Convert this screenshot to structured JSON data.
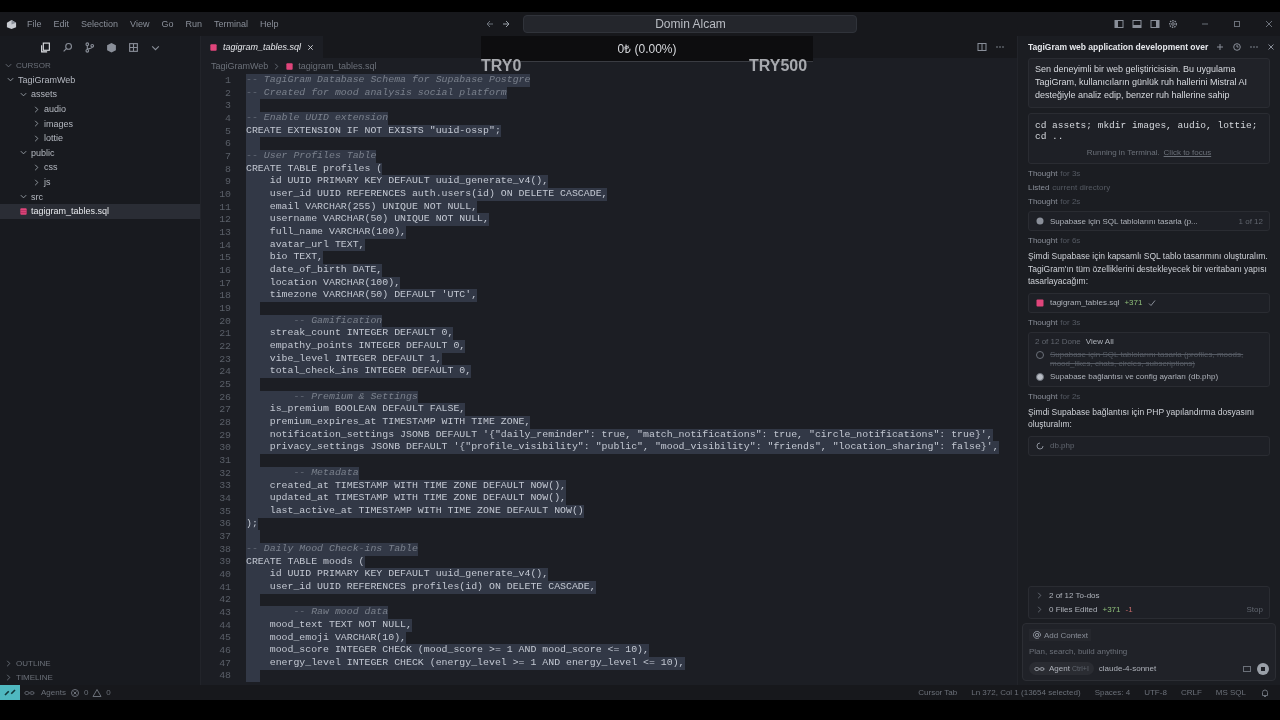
{
  "menu": [
    "File",
    "Edit",
    "Selection",
    "View",
    "Go",
    "Run",
    "Terminal",
    "Help"
  ],
  "command_center": {
    "title": "Domin Alcam"
  },
  "price_overlay": {
    "change": "0₺ (0.00%)",
    "min_label": "TRY0",
    "max_label": "TRY500"
  },
  "explorer": {
    "section": "CURSOR",
    "tree": [
      {
        "label": "TagiGramWeb",
        "kind": "folder",
        "expanded": true,
        "selected": false,
        "children": [
          {
            "label": "assets",
            "kind": "folder",
            "expanded": true,
            "selected": false,
            "children": [
              {
                "label": "audio",
                "kind": "folder",
                "expanded": false,
                "selected": false
              },
              {
                "label": "images",
                "kind": "folder",
                "expanded": false,
                "selected": false
              },
              {
                "label": "lottie",
                "kind": "folder",
                "expanded": false,
                "selected": false
              }
            ]
          },
          {
            "label": "public",
            "kind": "folder",
            "expanded": true,
            "selected": false,
            "children": [
              {
                "label": "css",
                "kind": "folder",
                "expanded": false,
                "selected": false
              },
              {
                "label": "js",
                "kind": "folder",
                "expanded": false,
                "selected": false
              }
            ]
          },
          {
            "label": "src",
            "kind": "folder",
            "expanded": true,
            "selected": false
          },
          {
            "label": "tagigram_tables.sql",
            "kind": "file",
            "selected": true
          }
        ]
      }
    ],
    "bottom_sections": [
      "OUTLINE",
      "TIMELINE"
    ]
  },
  "editor": {
    "tab": {
      "label": "tagigram_tables.sql",
      "selected": true
    },
    "breadcrumb": [
      "TagiGramWeb",
      "tagigram_tables.sql"
    ],
    "selected": true,
    "lines": [
      {
        "number": "1",
        "kind": "comment",
        "text": "-- TagiGram Database Schema for Supabase Postgre"
      },
      {
        "number": "2",
        "kind": "comment",
        "text": "-- Created for mood analysis social platform"
      },
      {
        "number": "3"
      },
      {
        "number": "4",
        "kind": "comment",
        "text": "-- Enable UUID extension"
      },
      {
        "number": "5",
        "kind": "code",
        "text": "CREATE EXTENSION IF NOT EXISTS \"uuid-ossp\";"
      },
      {
        "number": "6"
      },
      {
        "number": "7",
        "kind": "comment",
        "text": "-- User Profiles Table"
      },
      {
        "number": "8",
        "kind": "code",
        "text": "CREATE TABLE profiles ("
      },
      {
        "number": "9",
        "kind": "code",
        "text": "    id UUID PRIMARY KEY DEFAULT uuid_generate_v4(),"
      },
      {
        "number": "10",
        "kind": "code",
        "text": "    user_id UUID REFERENCES auth.users(id) ON DELETE CASCADE,"
      },
      {
        "number": "11",
        "kind": "code",
        "text": "    email VARCHAR(255) UNIQUE NOT NULL,"
      },
      {
        "number": "12",
        "kind": "code",
        "text": "    username VARCHAR(50) UNIQUE NOT NULL,"
      },
      {
        "number": "13",
        "kind": "code",
        "text": "    full_name VARCHAR(100),"
      },
      {
        "number": "14",
        "kind": "code",
        "text": "    avatar_url TEXT,"
      },
      {
        "number": "15",
        "kind": "code",
        "text": "    bio TEXT,"
      },
      {
        "number": "16",
        "kind": "code",
        "text": "    date_of_birth DATE,"
      },
      {
        "number": "17",
        "kind": "code",
        "text": "    location VARCHAR(100),"
      },
      {
        "number": "18",
        "kind": "code",
        "text": "    timezone VARCHAR(50) DEFAULT 'UTC',"
      },
      {
        "number": "19"
      },
      {
        "number": "20",
        "kind": "comment",
        "text": "        -- Gamification"
      },
      {
        "number": "21",
        "kind": "code",
        "text": "    streak_count INTEGER DEFAULT 0,"
      },
      {
        "number": "22",
        "kind": "code",
        "text": "    empathy_points INTEGER DEFAULT 0,"
      },
      {
        "number": "23",
        "kind": "code",
        "text": "    vibe_level INTEGER DEFAULT 1,"
      },
      {
        "number": "24",
        "kind": "code",
        "text": "    total_check_ins INTEGER DEFAULT 0,"
      },
      {
        "number": "25"
      },
      {
        "number": "26",
        "kind": "comment",
        "text": "        -- Premium & Settings"
      },
      {
        "number": "27",
        "kind": "code",
        "text": "    is_premium BOOLEAN DEFAULT FALSE,"
      },
      {
        "number": "28",
        "kind": "code",
        "text": "    premium_expires_at TIMESTAMP WITH TIME ZONE,"
      },
      {
        "number": "29",
        "kind": "code",
        "text": "    notification_settings JSONB DEFAULT '{\"daily_reminder\": true, \"match_notifications\": true, \"circle_notifications\": true}',"
      },
      {
        "number": "30",
        "kind": "code",
        "text": "    privacy_settings JSONB DEFAULT '{\"profile_visibility\": \"public\", \"mood_visibility\": \"friends\", \"location_sharing\": false}',"
      },
      {
        "number": "31"
      },
      {
        "number": "32",
        "kind": "comment",
        "text": "        -- Metadata"
      },
      {
        "number": "33",
        "kind": "code",
        "text": "    created_at TIMESTAMP WITH TIME ZONE DEFAULT NOW(),"
      },
      {
        "number": "34",
        "kind": "code",
        "text": "    updated_at TIMESTAMP WITH TIME ZONE DEFAULT NOW(),"
      },
      {
        "number": "35",
        "kind": "code",
        "text": "    last_active_at TIMESTAMP WITH TIME ZONE DEFAULT NOW()"
      },
      {
        "number": "36",
        "kind": "code",
        "text": ");"
      },
      {
        "number": "37"
      },
      {
        "number": "38",
        "kind": "comment",
        "text": "-- Daily Mood Check-ins Table"
      },
      {
        "number": "39",
        "kind": "code",
        "text": "CREATE TABLE moods ("
      },
      {
        "number": "40",
        "kind": "code",
        "text": "    id UUID PRIMARY KEY DEFAULT uuid_generate_v4(),"
      },
      {
        "number": "41",
        "kind": "code",
        "text": "    user_id UUID REFERENCES profiles(id) ON DELETE CASCADE,"
      },
      {
        "number": "42"
      },
      {
        "number": "43",
        "kind": "comment",
        "text": "        -- Raw mood data"
      },
      {
        "number": "44",
        "kind": "code",
        "text": "    mood_text TEXT NOT NULL,"
      },
      {
        "number": "45",
        "kind": "code",
        "text": "    mood_emoji VARCHAR(10),"
      },
      {
        "number": "46",
        "kind": "code",
        "text": "    mood_score INTEGER CHECK (mood_score >= 1 AND mood_score <= 10),"
      },
      {
        "number": "47",
        "kind": "code",
        "text": "    energy_level INTEGER CHECK (energy_level >= 1 AND energy_level <= 10),"
      },
      {
        "number": "48"
      }
    ]
  },
  "chat": {
    "title": "TagiGram web application development over",
    "messages": [
      {
        "kind": "user_message",
        "text": "Sen deneyimli bir web geliştiricisisin. Bu uygulama TagiGram, kullanıcıların günlük ruh hallerini Mistral AI desteğiyle analiz edip, benzer ruh hallerine sahip"
      },
      {
        "kind": "terminal",
        "command": "cd assets; mkdir images, audio, lottie; cd ..",
        "status": "Running in Terminal.",
        "link": "Click to focus"
      },
      {
        "kind": "step",
        "label": "Thought",
        "detail": "for 3s"
      },
      {
        "kind": "step",
        "label": "Listed",
        "detail": "current directory"
      },
      {
        "kind": "step",
        "label": "Thought",
        "detail": "for 2s"
      },
      {
        "kind": "todo",
        "text": "Supabase için SQL tablolarını tasarla (p...",
        "counter": "1 of 12"
      },
      {
        "kind": "step",
        "label": "Thought",
        "detail": "for 6s"
      },
      {
        "kind": "paragraph",
        "text": "Şimdi Supabase için kapsamlı SQL tablo tasarımını oluşturalım. TagiGram'ın tüm özelliklerini destekleyecek bir veritabanı yapısı tasarlayacağım:"
      },
      {
        "kind": "file",
        "name": "tagigram_tables.sql",
        "added": "+371",
        "done": true
      },
      {
        "kind": "step",
        "label": "Thought",
        "detail": "for 3s"
      },
      {
        "kind": "todo_list",
        "summary": "2 of 12 Done",
        "link": "View All",
        "items": [
          {
            "text": "Supabase için SQL tablolarını tasarla (profiles, moods, mood_likes, chats, circles, subscriptions)",
            "done": true
          },
          {
            "text": "Supabase bağlantısı ve config ayarları (db.php)",
            "done": false
          }
        ]
      },
      {
        "kind": "step",
        "label": "Thought",
        "detail": "for 2s"
      },
      {
        "kind": "paragraph",
        "text": "Şimdi Supabase bağlantısı için PHP yapılandırma dosyasını oluşturalım:"
      },
      {
        "kind": "file",
        "name": "db.php",
        "done": false
      }
    ],
    "summary": {
      "todos": "2 of 12 To-dos",
      "files": "0 Files Edited",
      "added": "+371",
      "removed": "-1",
      "stop": "Stop"
    },
    "composer": {
      "context": "Add Context",
      "placeholder": "Plan, search, build anything",
      "mode": "Agent",
      "mode_shortcut": "Ctrl+I",
      "model": "claude-4-sonnet"
    }
  },
  "status_bar": {
    "agents": "Agents",
    "errors": "0",
    "warnings": "0",
    "right": [
      "Cursor Tab",
      "Ln 372, Col 1 (13654 selected)",
      "Spaces: 4",
      "UTF-8",
      "CRLF",
      "MS SQL"
    ]
  }
}
